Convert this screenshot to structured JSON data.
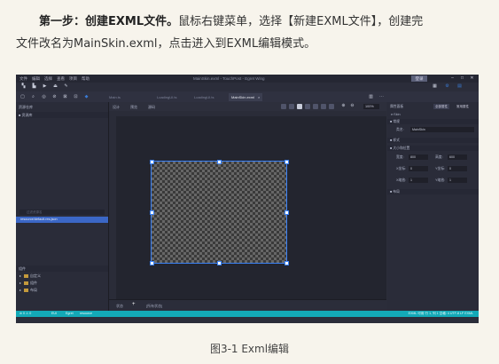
{
  "paragraph": {
    "step_bold": "第一步：创建EXML文件。",
    "text_1": "鼠标右键菜单，选择【新建EXML文件】，创建完",
    "text_2": "文件改名为MainSkin.exml，点击进入到EXML编辑模式。"
  },
  "caption": "图3-1 Exml编辑",
  "screenshot": {
    "menu": [
      "文件",
      "编辑",
      "选择",
      "查看",
      "项目",
      "帮助"
    ],
    "window_title": "MainSkin.exml - TouchPost - Egret Wing",
    "login_label": "登录",
    "window_controls": [
      "minimize-icon",
      "maximize-icon",
      "close-icon"
    ],
    "tabs": [
      {
        "label": "Main.ts",
        "active": false
      },
      {
        "label": "LoadingUI.ts",
        "active": false
      },
      {
        "label": "LoadingUI.ts",
        "active": false
      },
      {
        "label": "MainSkin.exml",
        "active": true
      }
    ],
    "tab_close": "×",
    "left_panel": {
      "header_top": "资源仓库",
      "sub_header": "■ 资源库",
      "search_placeholder": "过滤资源名",
      "resource_file": "resource/default.res.json",
      "components_header": "组件",
      "tree": [
        "自定义",
        "组件",
        "布局"
      ]
    },
    "center": {
      "mode_design": "设计",
      "mode_preview": "预览",
      "mode_source": "源码",
      "zoom": "100%",
      "bottom_tabs": [
        "状态",
        "+",
        "[所有状态]"
      ]
    },
    "right_panel": {
      "header": "属性面板",
      "btn_all": "全部属性",
      "btn_common": "常用属性",
      "skin_node": "e:Skin",
      "section_common": "■ 常规",
      "class_label": "类名:",
      "class_value": "MainSkin",
      "section_style": "■ 样式",
      "section_size": "■ 大小和位置",
      "width_label": "宽度:",
      "width_value": "800",
      "height_label": "高度:",
      "height_value": "600",
      "x_label": "X坐标:",
      "x_value": "0",
      "y_label": "Y坐标:",
      "y_value": "0",
      "sx_label": "X缩放:",
      "sx_value": "1",
      "sy_label": "Y缩放:",
      "sy_value": "1",
      "section_layout": "■ 布局"
    },
    "status_bar": {
      "left": "⊘ 0 ⚠ 0",
      "eui": "EUI",
      "egret": "Egret",
      "project": "resource",
      "right": "EXML 可用  行 1, 列 1  空格: 4  UTF-8  LF  EXML"
    },
    "colors": {
      "canvas_border": "#3b82f6",
      "status_bar": "#13a9b7",
      "selected_row": "#3b67c6"
    }
  }
}
